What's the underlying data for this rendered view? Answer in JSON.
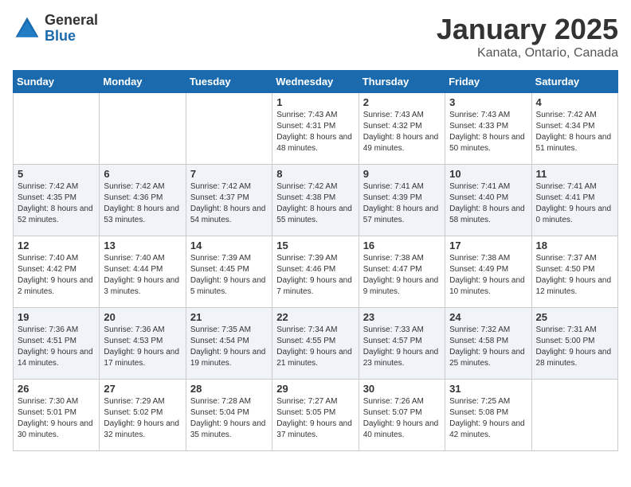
{
  "header": {
    "logo_general": "General",
    "logo_blue": "Blue",
    "title": "January 2025",
    "subtitle": "Kanata, Ontario, Canada"
  },
  "weekdays": [
    "Sunday",
    "Monday",
    "Tuesday",
    "Wednesday",
    "Thursday",
    "Friday",
    "Saturday"
  ],
  "weeks": [
    [
      {
        "day": "",
        "info": ""
      },
      {
        "day": "",
        "info": ""
      },
      {
        "day": "",
        "info": ""
      },
      {
        "day": "1",
        "info": "Sunrise: 7:43 AM\nSunset: 4:31 PM\nDaylight: 8 hours\nand 48 minutes."
      },
      {
        "day": "2",
        "info": "Sunrise: 7:43 AM\nSunset: 4:32 PM\nDaylight: 8 hours\nand 49 minutes."
      },
      {
        "day": "3",
        "info": "Sunrise: 7:43 AM\nSunset: 4:33 PM\nDaylight: 8 hours\nand 50 minutes."
      },
      {
        "day": "4",
        "info": "Sunrise: 7:42 AM\nSunset: 4:34 PM\nDaylight: 8 hours\nand 51 minutes."
      }
    ],
    [
      {
        "day": "5",
        "info": "Sunrise: 7:42 AM\nSunset: 4:35 PM\nDaylight: 8 hours\nand 52 minutes."
      },
      {
        "day": "6",
        "info": "Sunrise: 7:42 AM\nSunset: 4:36 PM\nDaylight: 8 hours\nand 53 minutes."
      },
      {
        "day": "7",
        "info": "Sunrise: 7:42 AM\nSunset: 4:37 PM\nDaylight: 8 hours\nand 54 minutes."
      },
      {
        "day": "8",
        "info": "Sunrise: 7:42 AM\nSunset: 4:38 PM\nDaylight: 8 hours\nand 55 minutes."
      },
      {
        "day": "9",
        "info": "Sunrise: 7:41 AM\nSunset: 4:39 PM\nDaylight: 8 hours\nand 57 minutes."
      },
      {
        "day": "10",
        "info": "Sunrise: 7:41 AM\nSunset: 4:40 PM\nDaylight: 8 hours\nand 58 minutes."
      },
      {
        "day": "11",
        "info": "Sunrise: 7:41 AM\nSunset: 4:41 PM\nDaylight: 9 hours\nand 0 minutes."
      }
    ],
    [
      {
        "day": "12",
        "info": "Sunrise: 7:40 AM\nSunset: 4:42 PM\nDaylight: 9 hours\nand 2 minutes."
      },
      {
        "day": "13",
        "info": "Sunrise: 7:40 AM\nSunset: 4:44 PM\nDaylight: 9 hours\nand 3 minutes."
      },
      {
        "day": "14",
        "info": "Sunrise: 7:39 AM\nSunset: 4:45 PM\nDaylight: 9 hours\nand 5 minutes."
      },
      {
        "day": "15",
        "info": "Sunrise: 7:39 AM\nSunset: 4:46 PM\nDaylight: 9 hours\nand 7 minutes."
      },
      {
        "day": "16",
        "info": "Sunrise: 7:38 AM\nSunset: 4:47 PM\nDaylight: 9 hours\nand 9 minutes."
      },
      {
        "day": "17",
        "info": "Sunrise: 7:38 AM\nSunset: 4:49 PM\nDaylight: 9 hours\nand 10 minutes."
      },
      {
        "day": "18",
        "info": "Sunrise: 7:37 AM\nSunset: 4:50 PM\nDaylight: 9 hours\nand 12 minutes."
      }
    ],
    [
      {
        "day": "19",
        "info": "Sunrise: 7:36 AM\nSunset: 4:51 PM\nDaylight: 9 hours\nand 14 minutes."
      },
      {
        "day": "20",
        "info": "Sunrise: 7:36 AM\nSunset: 4:53 PM\nDaylight: 9 hours\nand 17 minutes."
      },
      {
        "day": "21",
        "info": "Sunrise: 7:35 AM\nSunset: 4:54 PM\nDaylight: 9 hours\nand 19 minutes."
      },
      {
        "day": "22",
        "info": "Sunrise: 7:34 AM\nSunset: 4:55 PM\nDaylight: 9 hours\nand 21 minutes."
      },
      {
        "day": "23",
        "info": "Sunrise: 7:33 AM\nSunset: 4:57 PM\nDaylight: 9 hours\nand 23 minutes."
      },
      {
        "day": "24",
        "info": "Sunrise: 7:32 AM\nSunset: 4:58 PM\nDaylight: 9 hours\nand 25 minutes."
      },
      {
        "day": "25",
        "info": "Sunrise: 7:31 AM\nSunset: 5:00 PM\nDaylight: 9 hours\nand 28 minutes."
      }
    ],
    [
      {
        "day": "26",
        "info": "Sunrise: 7:30 AM\nSunset: 5:01 PM\nDaylight: 9 hours\nand 30 minutes."
      },
      {
        "day": "27",
        "info": "Sunrise: 7:29 AM\nSunset: 5:02 PM\nDaylight: 9 hours\nand 32 minutes."
      },
      {
        "day": "28",
        "info": "Sunrise: 7:28 AM\nSunset: 5:04 PM\nDaylight: 9 hours\nand 35 minutes."
      },
      {
        "day": "29",
        "info": "Sunrise: 7:27 AM\nSunset: 5:05 PM\nDaylight: 9 hours\nand 37 minutes."
      },
      {
        "day": "30",
        "info": "Sunrise: 7:26 AM\nSunset: 5:07 PM\nDaylight: 9 hours\nand 40 minutes."
      },
      {
        "day": "31",
        "info": "Sunrise: 7:25 AM\nSunset: 5:08 PM\nDaylight: 9 hours\nand 42 minutes."
      },
      {
        "day": "",
        "info": ""
      }
    ]
  ]
}
